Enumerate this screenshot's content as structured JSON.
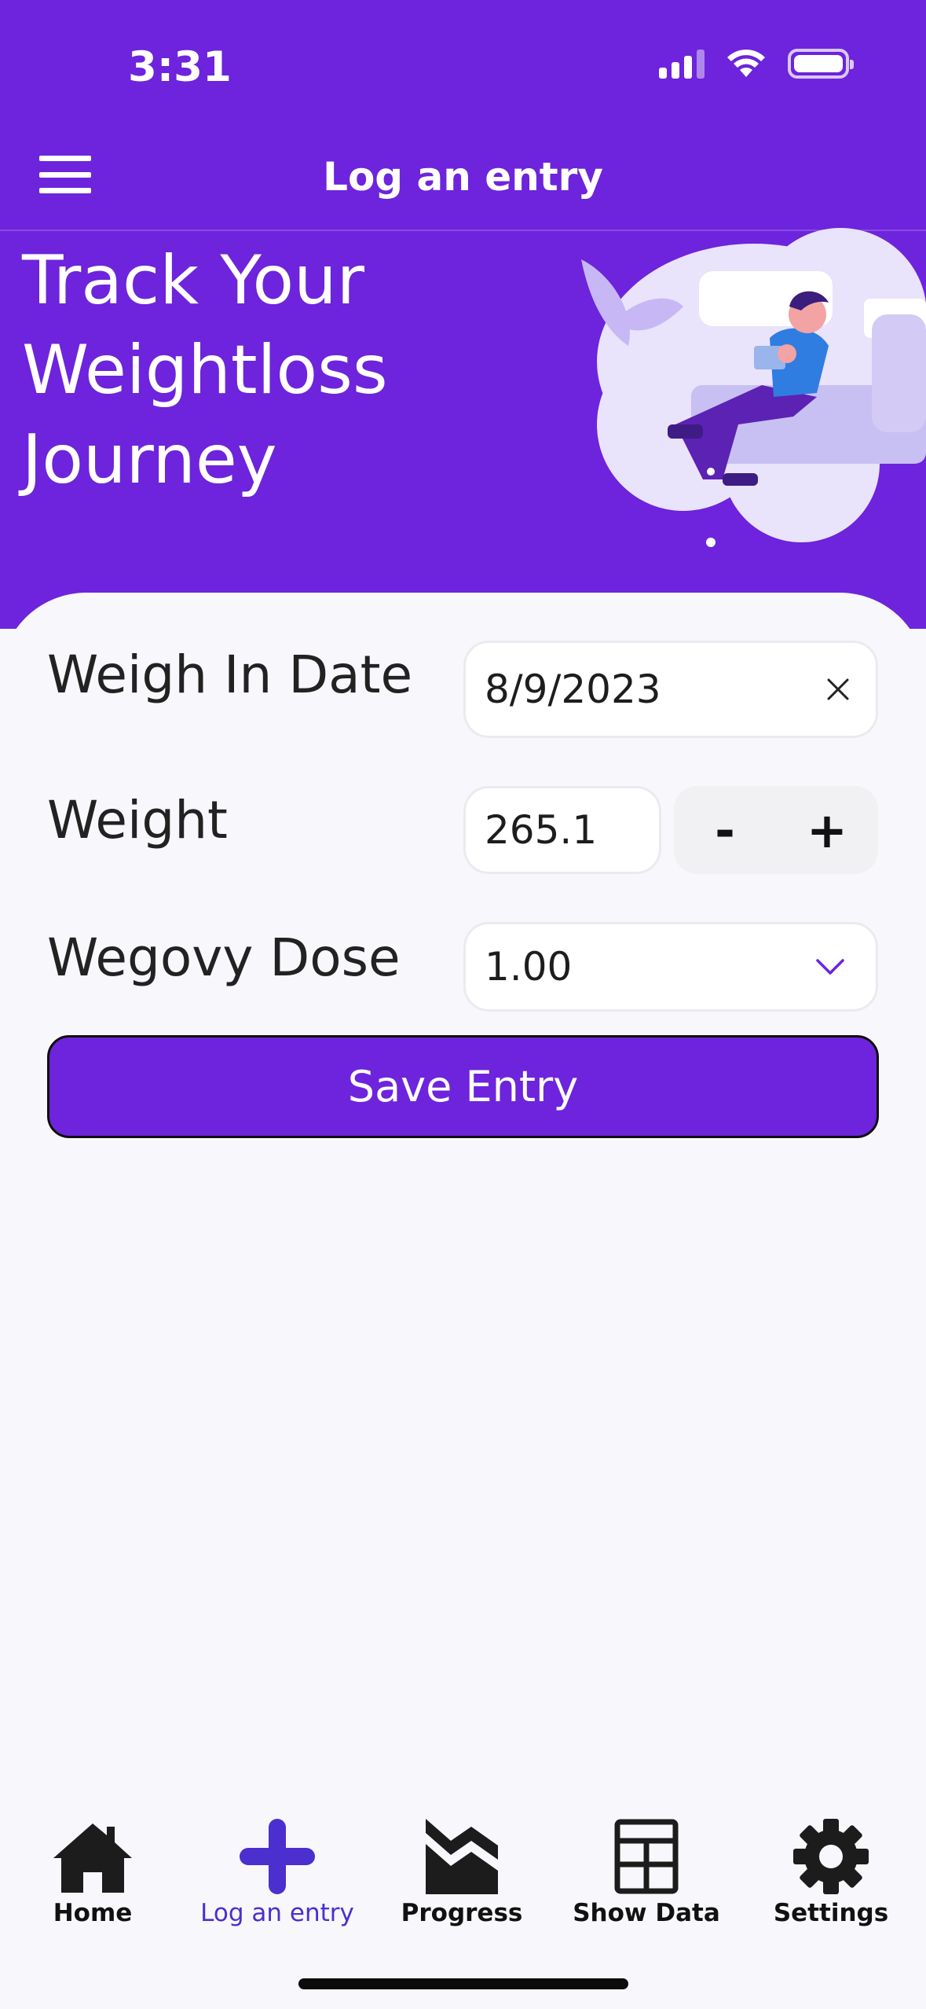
{
  "status_bar": {
    "time": "3:31"
  },
  "header": {
    "title": "Log an entry"
  },
  "hero": {
    "title": "Track Your Weightloss Journey"
  },
  "form": {
    "date": {
      "label": "Weigh In Date",
      "value": "8/9/2023"
    },
    "weight": {
      "label": "Weight",
      "value": "265.1",
      "decrement": "-",
      "increment": "+"
    },
    "dose": {
      "label": "Wegovy Dose",
      "value": "1.00"
    },
    "save_label": "Save Entry"
  },
  "tabs": [
    {
      "label": "Home",
      "icon": "home-icon"
    },
    {
      "label": "Log an entry",
      "icon": "plus-icon",
      "active": true
    },
    {
      "label": "Progress",
      "icon": "chart-icon"
    },
    {
      "label": "Show Data",
      "icon": "table-icon"
    },
    {
      "label": "Settings",
      "icon": "gear-icon"
    }
  ],
  "colors": {
    "brand": "#6d24dc",
    "active_tab": "#4b2fcf",
    "background": "#f8f7fc"
  }
}
